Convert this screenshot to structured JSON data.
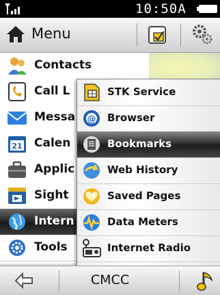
{
  "status": {
    "time": "10:50A"
  },
  "menubar": {
    "title": "Menu"
  },
  "main_items": [
    {
      "label": "Contacts",
      "icon": "contacts-icon"
    },
    {
      "label": "Call L",
      "icon": "call-log-icon"
    },
    {
      "label": "Messa",
      "icon": "messages-icon"
    },
    {
      "label": "Calen",
      "icon": "calendar-icon"
    },
    {
      "label": "Applic",
      "icon": "applications-icon"
    },
    {
      "label": "Sight",
      "icon": "sight-icon"
    },
    {
      "label": "Intern",
      "icon": "internet-icon"
    },
    {
      "label": "Tools",
      "icon": "tools-icon"
    }
  ],
  "submenu": [
    {
      "label": "STK Service",
      "icon": "sim-card-icon"
    },
    {
      "label": "Browser",
      "icon": "browser-icon"
    },
    {
      "label": "Bookmarks",
      "icon": "bookmarks-icon"
    },
    {
      "label": "Web History",
      "icon": "web-history-icon"
    },
    {
      "label": "Saved Pages",
      "icon": "saved-pages-icon"
    },
    {
      "label": "Data Meters",
      "icon": "data-meters-icon"
    },
    {
      "label": "Internet Radio",
      "icon": "internet-radio-icon"
    }
  ],
  "bottombar": {
    "operator": "CMCC"
  },
  "colors": {
    "selection": "#1a1a1a",
    "accent_yellow": "#f5c400",
    "background": "#ffffff"
  }
}
